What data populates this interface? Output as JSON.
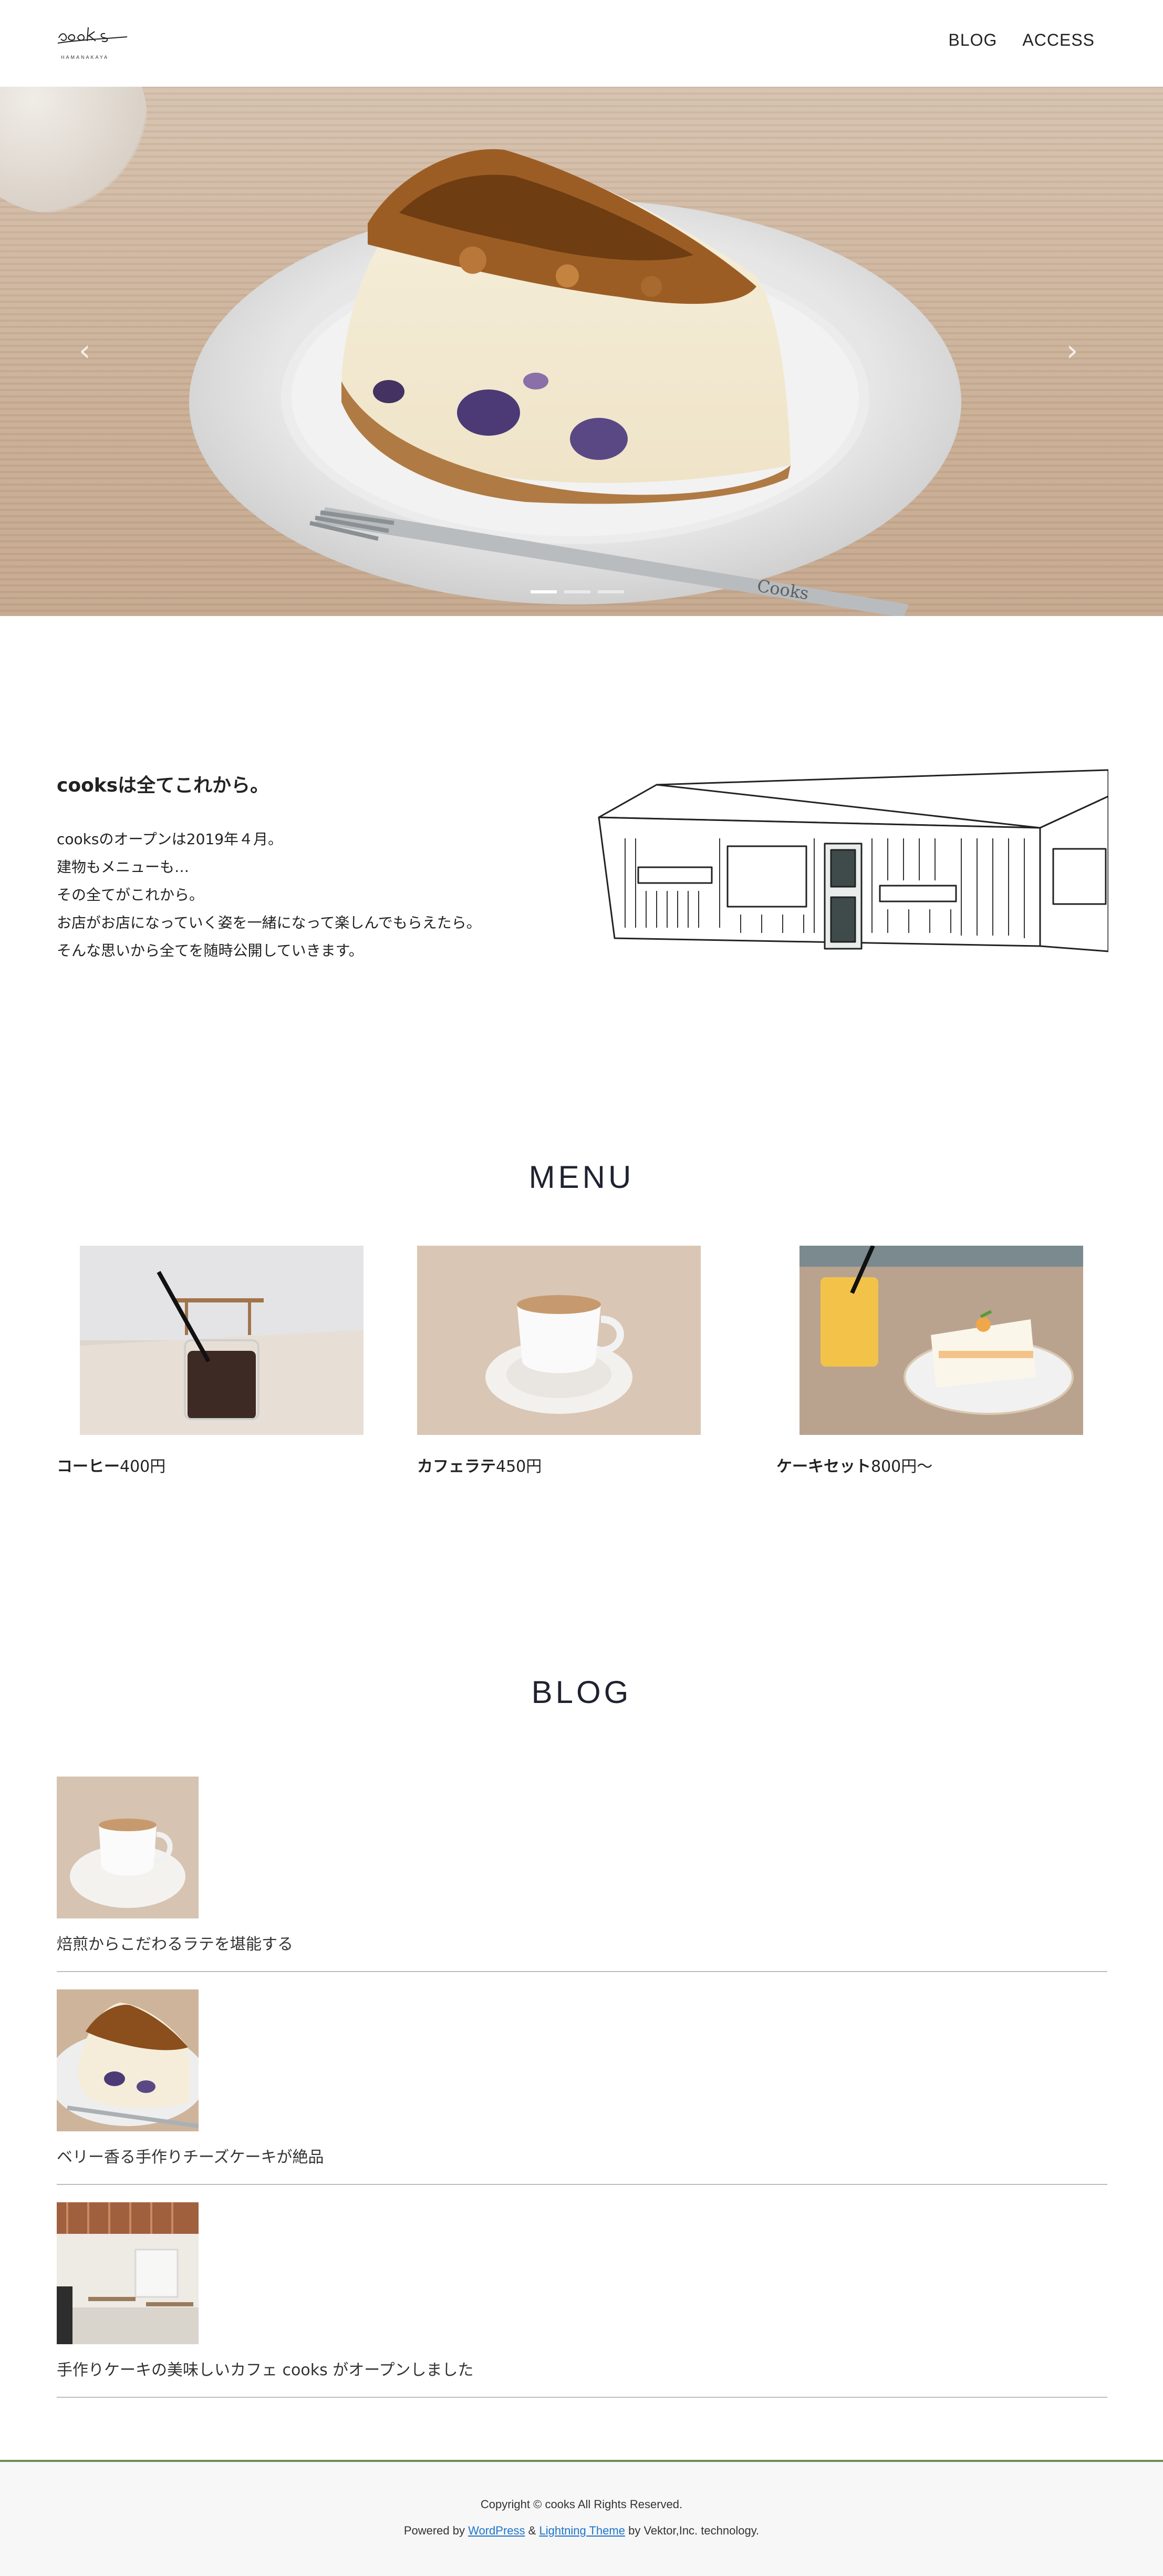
{
  "header": {
    "logo_text": "cooks",
    "logo_subtext": "HAMANAKAYA",
    "nav": [
      "BLOG",
      "ACCESS"
    ]
  },
  "hero": {
    "prev_icon": "chevron-left-icon",
    "next_icon": "chevron-right-icon",
    "slide_count": 3,
    "active_slide": 1,
    "plate_text": "Cooks"
  },
  "about": {
    "title": "cooksは全てこれから。",
    "lines": [
      "cooksのオープンは2019年４月。",
      "建物もメニューも…",
      "その全てがこれから。",
      "お店がお店になっていく姿を一緒になって楽しんでもらえたら。",
      "そんな思いから全てを随時公開していきます。"
    ]
  },
  "menu": {
    "title": "MENU",
    "items": [
      {
        "name": "コーヒー",
        "price": "400円"
      },
      {
        "name": "カフェラテ",
        "price": "450円"
      },
      {
        "name": "ケーキセット",
        "price": "800円〜"
      }
    ]
  },
  "blog": {
    "title": "BLOG",
    "posts": [
      {
        "title": "焙煎からこだわるラテを堪能する"
      },
      {
        "title": "ベリー香る手作りチーズケーキが絶品"
      },
      {
        "title": "手作りケーキの美味しいカフェ cooks がオープンしました"
      }
    ]
  },
  "footer": {
    "copyright": "Copyright © cooks All Rights Reserved.",
    "powered_by": "Powered by",
    "wordpress": "WordPress",
    "amp": "&",
    "lightning": "Lightning Theme",
    "by_vektor": "by Vektor,Inc. technology."
  },
  "colors": {
    "footer_accent": "#6b8f57",
    "link": "#1f74c9"
  }
}
